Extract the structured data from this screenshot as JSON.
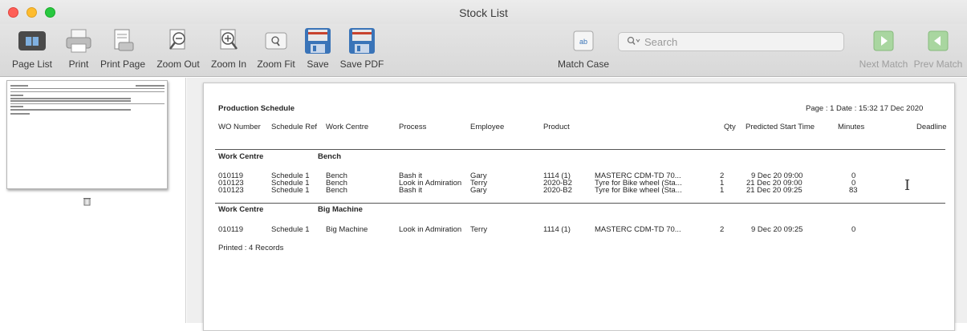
{
  "window": {
    "title": "Stock List"
  },
  "toolbar": {
    "page_list": "Page List",
    "print": "Print",
    "print_page": "Print Page",
    "zoom_out": "Zoom Out",
    "zoom_in": "Zoom In",
    "zoom_fit": "Zoom Fit",
    "save": "Save",
    "save_pdf": "Save PDF",
    "match_case": "Match Case",
    "search_placeholder": "Search",
    "next_match": "Next Match",
    "prev_match": "Prev Match"
  },
  "colors": {
    "accent_blue": "#3a74b8",
    "save_red": "#c8432e",
    "match_green": "#6fbf5a"
  },
  "report": {
    "title": "Production Schedule",
    "page_info": "Page : 1  Date : 15:32  17 Dec 2020",
    "headers": {
      "wo_number": "WO Number",
      "schedule_ref": "Schedule Ref",
      "work_centre": "Work Centre",
      "process": "Process",
      "employee": "Employee",
      "product": "Product",
      "qty": "Qty",
      "predicted_start": "Predicted Start Time",
      "minutes": "Minutes",
      "deadline": "Deadline"
    },
    "group1": {
      "label": "Work Centre",
      "name": "Bench",
      "rows": [
        {
          "wo": "010119",
          "sched": "Schedule 1",
          "wc": "Bench",
          "process": "Bash it",
          "employee": "Gary",
          "product": "1114 (1)",
          "desc": "MASTERC CDM-TD 70...",
          "qty": "2",
          "start": "9 Dec 20  09:00",
          "minutes": "0"
        },
        {
          "wo": "010123",
          "sched": "Schedule 1",
          "wc": "Bench",
          "process": "Look in Admiration",
          "employee": "Terry",
          "product": "2020-B2",
          "desc": "Tyre for Bike wheel (Sta...",
          "qty": "1",
          "start": "21 Dec 20  09:00",
          "minutes": "0"
        },
        {
          "wo": "010123",
          "sched": "Schedule 1",
          "wc": "Bench",
          "process": "Bash it",
          "employee": "Gary",
          "product": "2020-B2",
          "desc": "Tyre for Bike wheel (Sta...",
          "qty": "1",
          "start": "21 Dec 20  09:25",
          "minutes": "83"
        }
      ]
    },
    "group2": {
      "label": "Work Centre",
      "name": "Big Machine",
      "rows": [
        {
          "wo": "010119",
          "sched": "Schedule 1",
          "wc": "Big Machine",
          "process": "Look in Admiration",
          "employee": "Terry",
          "product": "1114 (1)",
          "desc": "MASTERC CDM-TD 70...",
          "qty": "2",
          "start": "9 Dec 20  09:25",
          "minutes": "0"
        }
      ]
    },
    "footer": "Printed : 4 Records"
  }
}
